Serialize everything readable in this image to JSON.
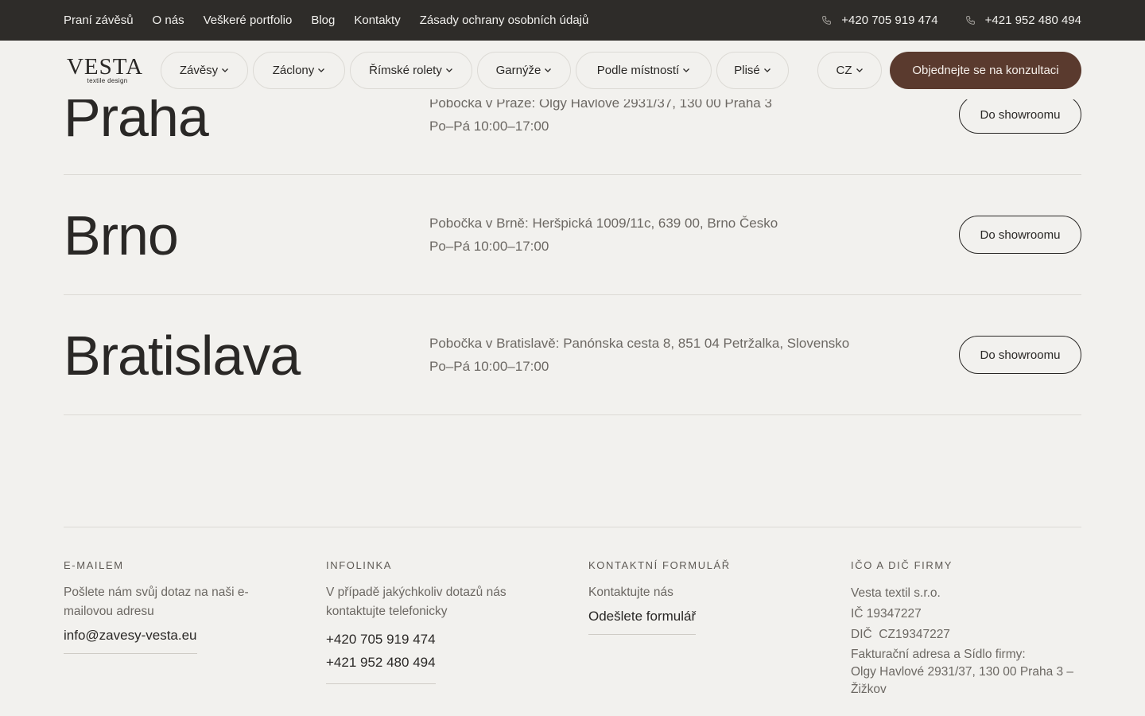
{
  "topbar": {
    "links": [
      "Praní závěsů",
      "O nás",
      "Veškeré portfolio",
      "Blog",
      "Kontakty",
      "Zásady ochrany osobních údajů"
    ],
    "phones": [
      "+420 705 919 474",
      "+421 952 480 494"
    ]
  },
  "header": {
    "logo_main": "VESTA",
    "logo_sub": "textile design",
    "nav": [
      "Závěsy",
      "Záclony",
      "Římské rolety",
      "Garnýže",
      "Podle místností",
      "Plisé"
    ],
    "language": "CZ",
    "cta": "Objednejte se na konzultaci"
  },
  "branches": [
    {
      "city": "Praha",
      "address": "Pobočka v Praze: Olgy Havlové 2931/37, 130 00 Praha 3",
      "hours": "Po–Pá 10:00–17:00",
      "button": "Do showroomu"
    },
    {
      "city": "Brno",
      "address": "Pobočka v Brně: Heršpická 1009/11c, 639 00, Brno Česko",
      "hours": "Po–Pá 10:00–17:00",
      "button": "Do showroomu"
    },
    {
      "city": "Bratislava",
      "address": "Pobočka v Bratislavě: Panónska cesta 8, 851 04 Petržalka, Slovensko",
      "hours": "Po–Pá 10:00–17:00",
      "button": "Do showroomu"
    }
  ],
  "footer": {
    "email": {
      "heading": "E-MAILEM",
      "desc": "Pošlete nám svůj dotaz na naši e-mailovou adresu",
      "value": "info@zavesy-vesta.eu"
    },
    "phone": {
      "heading": "INFOLINKA",
      "desc": "V případě jakýchkoliv dotazů nás kontaktujte telefonicky",
      "values": [
        "+420 705 919 474",
        "+421 952 480 494"
      ]
    },
    "form": {
      "heading": "KONTAKTNÍ FORMULÁŘ",
      "desc": "Kontaktujte nás",
      "link": "Odešlete formulář"
    },
    "company": {
      "heading": "IČO A DIČ FIRMY",
      "name": "Vesta textil s.r.o.",
      "ico": "IČ 19347227",
      "dic": "DIČ  CZ19347227",
      "address_label": "Fakturační adresa a Sídlo firmy:",
      "address": "Olgy Havlové 2931/37, 130 00 Praha 3 – Žižkov"
    }
  }
}
